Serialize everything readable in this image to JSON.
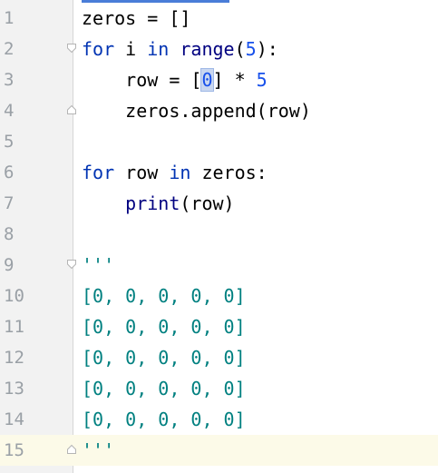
{
  "editor": {
    "accent_color": "#4a7dd8",
    "current_line_color": "#fcfae8",
    "colors": {
      "keyword": "#0033b3",
      "number": "#1750eb",
      "builtin": "#000080",
      "docstring": "#008080"
    },
    "lines": [
      {
        "number": "1",
        "tokens": [
          {
            "t": "zeros = []",
            "c": "plain"
          }
        ]
      },
      {
        "number": "2",
        "fold": "open",
        "tokens": [
          {
            "t": "for",
            "c": "kw"
          },
          {
            "t": " i ",
            "c": "plain"
          },
          {
            "t": "in",
            "c": "kw"
          },
          {
            "t": " ",
            "c": "plain"
          },
          {
            "t": "range",
            "c": "bi"
          },
          {
            "t": "(",
            "c": "plain"
          },
          {
            "t": "5",
            "c": "num"
          },
          {
            "t": "):",
            "c": "plain"
          }
        ]
      },
      {
        "number": "3",
        "tokens": [
          {
            "t": "    row = [",
            "c": "plain"
          },
          {
            "t": "0",
            "c": "num-hl"
          },
          {
            "t": "] * ",
            "c": "plain"
          },
          {
            "t": "5",
            "c": "num"
          }
        ]
      },
      {
        "number": "4",
        "fold": "close",
        "tokens": [
          {
            "t": "    zeros.append(row)",
            "c": "plain"
          }
        ]
      },
      {
        "number": "5",
        "tokens": []
      },
      {
        "number": "6",
        "tokens": [
          {
            "t": "for",
            "c": "kw"
          },
          {
            "t": " row ",
            "c": "plain"
          },
          {
            "t": "in",
            "c": "kw"
          },
          {
            "t": " zeros:",
            "c": "plain"
          }
        ]
      },
      {
        "number": "7",
        "tokens": [
          {
            "t": "    ",
            "c": "plain"
          },
          {
            "t": "print",
            "c": "bi"
          },
          {
            "t": "(row)",
            "c": "plain"
          }
        ]
      },
      {
        "number": "8",
        "tokens": []
      },
      {
        "number": "9",
        "fold": "open",
        "tokens": [
          {
            "t": "'''",
            "c": "doc"
          }
        ]
      },
      {
        "number": "10",
        "tokens": [
          {
            "t": "[0, 0, 0, 0, 0]",
            "c": "doc"
          }
        ]
      },
      {
        "number": "11",
        "tokens": [
          {
            "t": "[0, 0, 0, 0, 0]",
            "c": "doc"
          }
        ]
      },
      {
        "number": "12",
        "tokens": [
          {
            "t": "[0, 0, 0, 0, 0]",
            "c": "doc"
          }
        ]
      },
      {
        "number": "13",
        "tokens": [
          {
            "t": "[0, 0, 0, 0, 0]",
            "c": "doc"
          }
        ]
      },
      {
        "number": "14",
        "tokens": [
          {
            "t": "[0, 0, 0, 0, 0]",
            "c": "doc"
          }
        ]
      },
      {
        "number": "15",
        "fold": "close",
        "current": true,
        "tokens": [
          {
            "t": "'''",
            "c": "doc"
          }
        ]
      }
    ]
  }
}
